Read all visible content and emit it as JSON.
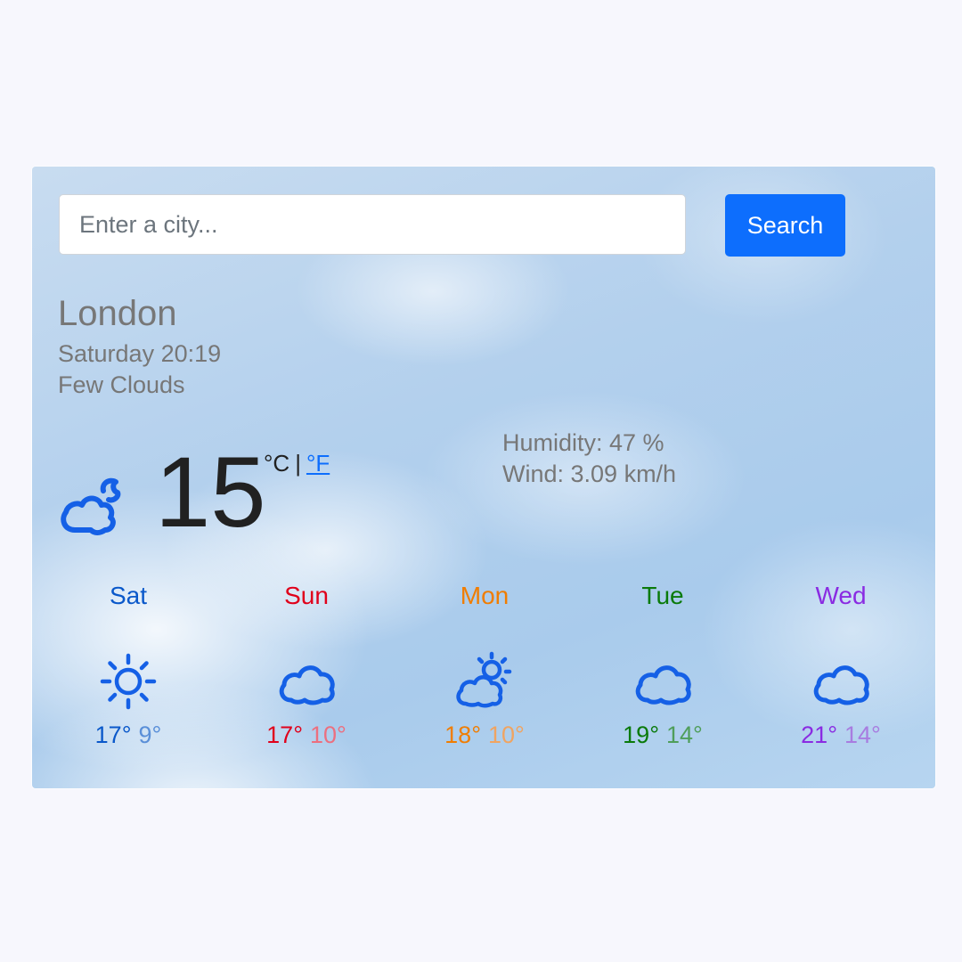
{
  "search": {
    "placeholder": "Enter a city...",
    "button_label": "Search"
  },
  "current": {
    "city": "London",
    "datetime": "Saturday 20:19",
    "condition": "Few Clouds",
    "icon": "partly-cloudy-night-icon",
    "temperature": "15",
    "unit_celsius": "°C",
    "unit_separator": "|",
    "unit_fahrenheit": "°F",
    "humidity": "Humidity: 47 %",
    "wind": "Wind: 3.09 km/h"
  },
  "forecast": [
    {
      "day": "Sat",
      "icon": "sun-icon",
      "max": "17°",
      "min": "9°",
      "color": "#0a58ca",
      "min_color": "#5a8fd8"
    },
    {
      "day": "Sun",
      "icon": "cloud-icon",
      "max": "17°",
      "min": "10°",
      "color": "#e0001b",
      "min_color": "#ec6f7f"
    },
    {
      "day": "Mon",
      "icon": "partly-cloudy-icon",
      "max": "18°",
      "min": "10°",
      "color": "#f07d00",
      "min_color": "#f0a461"
    },
    {
      "day": "Tue",
      "icon": "cloud-icon",
      "max": "19°",
      "min": "14°",
      "color": "#0a7a0a",
      "min_color": "#4f9e5a"
    },
    {
      "day": "Wed",
      "icon": "cloud-icon",
      "max": "21°",
      "min": "14°",
      "color": "#8a2be2",
      "min_color": "#a87ce0"
    }
  ],
  "colors": {
    "accent": "#0d6efd",
    "icon": "#1560e6"
  }
}
